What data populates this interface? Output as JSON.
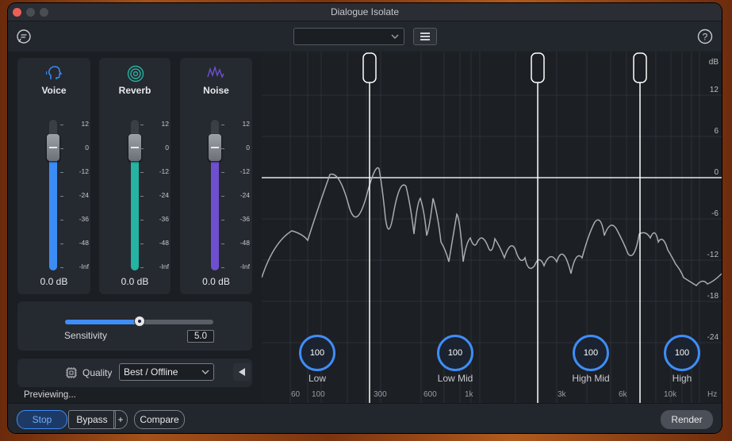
{
  "window": {
    "title": "Dialogue Isolate"
  },
  "toolbar": {
    "preset_value": "",
    "preset_placeholder": "",
    "chat_icon": "speech-bubble-icon",
    "menu_icon": "hamburger-icon",
    "help_label": "?"
  },
  "channels": [
    {
      "name": "Voice",
      "icon": "voice-head-icon",
      "value_label": "0.0 dB",
      "level_db": 0,
      "color": "#3b8cf5"
    },
    {
      "name": "Reverb",
      "icon": "reverb-rings-icon",
      "value_label": "0.0 dB",
      "level_db": 0,
      "color": "#25b3a3"
    },
    {
      "name": "Noise",
      "icon": "noise-wave-icon",
      "value_label": "0.0 dB",
      "level_db": 0,
      "color": "#6e4fd0"
    }
  ],
  "fader_scale": [
    "12",
    "0",
    "-12",
    "-24",
    "-36",
    "-48",
    "-Inf"
  ],
  "sensitivity": {
    "label": "Sensitivity",
    "value": "5.0",
    "fraction": 0.5
  },
  "quality": {
    "label": "Quality",
    "selected": "Best / Offline",
    "icon": "chip-icon"
  },
  "status": {
    "text": "Previewing..."
  },
  "spectrum": {
    "db_unit": "dB",
    "db_labels": [
      "12",
      "6",
      "0",
      "-6",
      "-12",
      "-18",
      "-24"
    ],
    "freq_unit": "Hz",
    "freq_labels": [
      "60",
      "100",
      "300",
      "600",
      "1k",
      "3k",
      "6k",
      "10k"
    ],
    "bands": [
      {
        "name": "Low",
        "value": "100"
      },
      {
        "name": "Low Mid",
        "value": "100"
      },
      {
        "name": "High Mid",
        "value": "100"
      },
      {
        "name": "High",
        "value": "100"
      }
    ]
  },
  "footer": {
    "stop": "Stop",
    "bypass": "Bypass",
    "plus": "+",
    "compare": "Compare",
    "render": "Render"
  },
  "colors": {
    "accent": "#3f8df6",
    "background": "#22262d"
  }
}
